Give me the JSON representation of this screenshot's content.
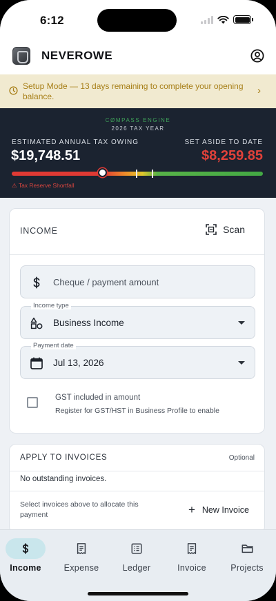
{
  "status_bar": {
    "time": "6:12"
  },
  "header": {
    "brand": "NEVEROWE"
  },
  "setup_banner": {
    "text": "Setup Mode — 13 days remaining to complete your opening balance."
  },
  "compass": {
    "engine_label": "CØMPASS ENGINE",
    "tax_year": "2026 TAX YEAR",
    "owing_label": "ESTIMATED ANNUAL TAX OWING",
    "owing_value": "$19,748.51",
    "set_aside_label": "SET ASIDE TO DATE",
    "set_aside_value": "$8,259.85",
    "shortfall_text": "⚠ Tax Reserve Shortfall",
    "marker_fraction": 0.36,
    "colors": {
      "shortfall": "#e03a34",
      "on_track": "#43a944"
    }
  },
  "income": {
    "title": "INCOME",
    "scan_label": "Scan",
    "amount_placeholder": "Cheque / payment amount",
    "income_type_label": "Income type",
    "income_type_value": "Business Income",
    "payment_date_label": "Payment date",
    "payment_date_value": "Jul 13, 2026",
    "gst_label": "GST included in amount",
    "gst_note": "Register for GST/HST in Business Profile to enable"
  },
  "invoices": {
    "title": "APPLY TO INVOICES",
    "optional": "Optional",
    "empty": "No outstanding invoices.",
    "hint": "Select invoices above to allocate this payment",
    "new_invoice": "New Invoice"
  },
  "nav": {
    "tabs": [
      {
        "label": "Income",
        "icon": "dollar-icon",
        "active": true
      },
      {
        "label": "Expense",
        "icon": "receipt-icon",
        "active": false
      },
      {
        "label": "Ledger",
        "icon": "ledger-icon",
        "active": false
      },
      {
        "label": "Invoice",
        "icon": "invoice-icon",
        "active": false
      },
      {
        "label": "Projects",
        "icon": "folder-icon",
        "active": false
      }
    ]
  }
}
